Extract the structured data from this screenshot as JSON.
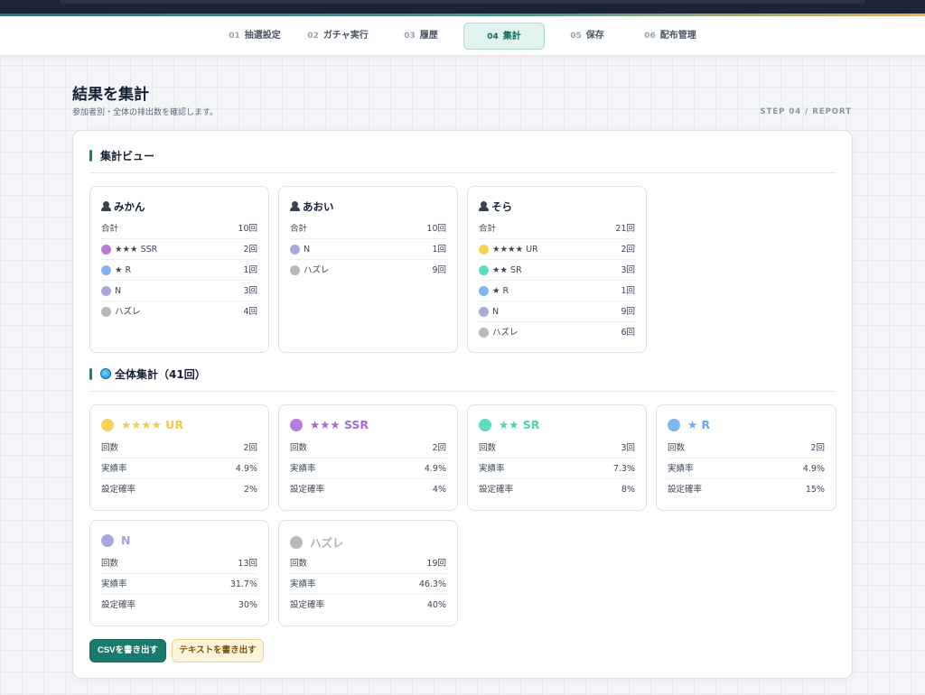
{
  "steps": [
    {
      "num": "01",
      "label": "抽選設定"
    },
    {
      "num": "02",
      "label": "ガチャ実行"
    },
    {
      "num": "03",
      "label": "履歴"
    },
    {
      "num": "04",
      "label": "集計"
    },
    {
      "num": "05",
      "label": "保存"
    },
    {
      "num": "06",
      "label": "配布管理"
    }
  ],
  "active_step": "04",
  "page": {
    "title": "結果を集計",
    "subtitle": "参加者別・全体の排出数を確認します。",
    "step_tag": "STEP 04 / REPORT"
  },
  "sections": {
    "summary_view": "集計ビュー",
    "overall": "全体集計（41回）"
  },
  "participants": [
    {
      "name": "みかん",
      "total_label": "合計",
      "total": "10回",
      "items": [
        {
          "label": "★★★ SSR",
          "count": "2回",
          "color": "#b57edc"
        },
        {
          "label": "★ R",
          "count": "1回",
          "color": "#7fb6f2"
        },
        {
          "label": "N",
          "count": "3回",
          "color": "#a9a9d9"
        },
        {
          "label": "ハズレ",
          "count": "4回",
          "color": "#b8b8b8"
        }
      ]
    },
    {
      "name": "あおい",
      "total_label": "合計",
      "total": "10回",
      "items": [
        {
          "label": "N",
          "count": "1回",
          "color": "#a9a9d9"
        },
        {
          "label": "ハズレ",
          "count": "9回",
          "color": "#b8b8b8"
        }
      ]
    },
    {
      "name": "そら",
      "total_label": "合計",
      "total": "21回",
      "items": [
        {
          "label": "★★★★ UR",
          "count": "2回",
          "color": "#f7d25a"
        },
        {
          "label": "★★ SR",
          "count": "3回",
          "color": "#5fdcc0"
        },
        {
          "label": "★ R",
          "count": "1回",
          "color": "#7fb6f2"
        },
        {
          "label": "N",
          "count": "9回",
          "color": "#a9a9d9"
        },
        {
          "label": "ハズレ",
          "count": "6回",
          "color": "#b8b8b8"
        }
      ]
    }
  ],
  "rarities": [
    {
      "name": "★★★★ UR",
      "color": "#f7d25a",
      "title_color": "#f2c94c",
      "count": "2回",
      "actual_rate": "4.9%",
      "set_rate": "2%"
    },
    {
      "name": "★★★ SSR",
      "color": "#b57edc",
      "title_color": "#a869d6",
      "count": "2回",
      "actual_rate": "4.9%",
      "set_rate": "4%"
    },
    {
      "name": "★★ SR",
      "color": "#5fdcc0",
      "title_color": "#4fd1b3",
      "count": "3回",
      "actual_rate": "7.3%",
      "set_rate": "8%"
    },
    {
      "name": "★ R",
      "color": "#7fb6f2",
      "title_color": "#6aa8ef",
      "count": "2回",
      "actual_rate": "4.9%",
      "set_rate": "15%"
    },
    {
      "name": "N",
      "color": "#a9a9d9",
      "title_color": "#a3a3d6",
      "count": "13回",
      "actual_rate": "31.7%",
      "set_rate": "30%"
    },
    {
      "name": "ハズレ",
      "color": "#b8b8b8",
      "title_color": "#b3b3b3",
      "count": "19回",
      "actual_rate": "46.3%",
      "set_rate": "40%"
    }
  ],
  "rarity_labels": {
    "count": "回数",
    "actual_rate": "実績率",
    "set_rate": "設定確率"
  },
  "buttons": {
    "csv": "CSVを書き出す",
    "text": "テキストを書き出す"
  }
}
